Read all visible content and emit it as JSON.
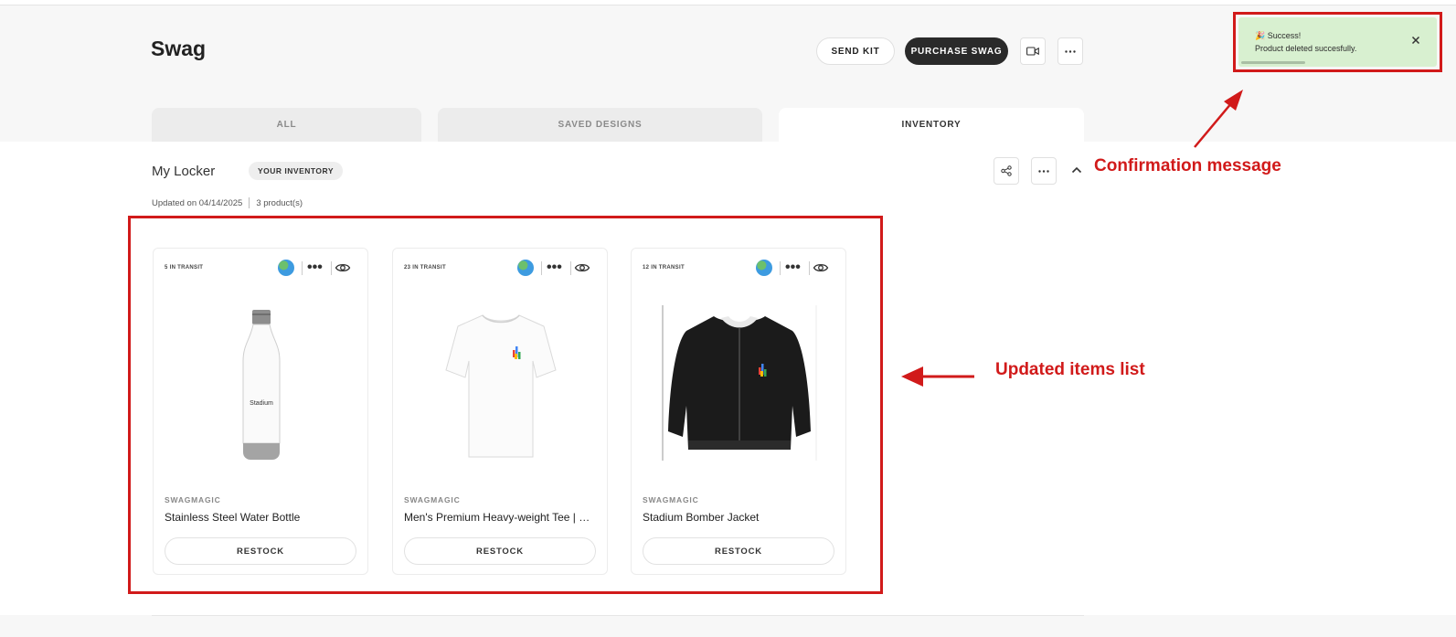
{
  "header": {
    "title": "Swag",
    "send_kit_label": "SEND KIT",
    "purchase_label": "PURCHASE SWAG",
    "video_icon": "video-camera-icon",
    "more_icon": "more-horizontal-icon"
  },
  "tabs": [
    {
      "label": "ALL",
      "active": false
    },
    {
      "label": "SAVED DESIGNS",
      "active": false
    },
    {
      "label": "INVENTORY",
      "active": true
    }
  ],
  "locker": {
    "title": "My Locker",
    "badge": "YOUR INVENTORY",
    "updated": "Updated on 04/14/2025",
    "count": "3 product(s)"
  },
  "products": [
    {
      "transit": "5 IN TRANSIT",
      "brand": "SWAGMAGIC",
      "name": "Stainless Steel Water Bottle",
      "action": "RESTOCK",
      "image_text": "Stadium"
    },
    {
      "transit": "23 IN TRANSIT",
      "brand": "SWAGMAGIC",
      "name": "Men's Premium Heavy-weight Tee | Cotton",
      "action": "RESTOCK"
    },
    {
      "transit": "12 IN TRANSIT",
      "brand": "SWAGMAGIC",
      "name": "Stadium Bomber Jacket",
      "action": "RESTOCK"
    }
  ],
  "toast": {
    "title": "🎉 Success!",
    "message": "Product deleted succesfully.",
    "progress": 0.33,
    "color": "#d8f0d0"
  },
  "annotations": {
    "confirmation": "Confirmation message",
    "updated_items": "Updated items list",
    "color": "#d11a1a"
  }
}
